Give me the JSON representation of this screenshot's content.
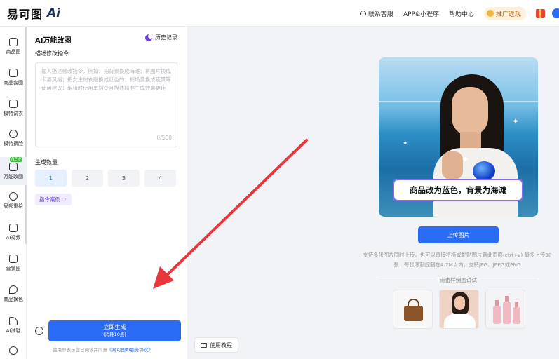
{
  "header": {
    "logo_text": "易可图",
    "logo_ai": "Ai",
    "nav": [
      "联系客服",
      "APP&小程序",
      "帮助中心"
    ],
    "promo_label": "推广返现"
  },
  "sidebar": {
    "items": [
      {
        "label": "商品图"
      },
      {
        "label": "商品套图"
      },
      {
        "label": "模特试衣"
      },
      {
        "label": "模特换脸"
      },
      {
        "label": "万能改图",
        "badge": "NEW"
      },
      {
        "label": "局部重绘"
      },
      {
        "label": "AI视频"
      },
      {
        "label": "营销图"
      },
      {
        "label": "商品换色"
      },
      {
        "label": "AI试鞋"
      },
      {
        "label": ""
      }
    ]
  },
  "panel": {
    "title": "AI万能改图",
    "history": "历史记录",
    "desc_label": "描述修改指令",
    "textarea_placeholder": "输入描述修改指令，例如：把背景换成海滩；将图片换成卡通风格；把女生的衣服换成红色的；把场景换成夜景等\n使用建议：编辑时使用单指令且描述精准生成效果更佳",
    "counter": "0/500",
    "count_label": "生成数量",
    "counts": [
      "1",
      "2",
      "3",
      "4"
    ],
    "case_label": "指令案例",
    "generate_label": "立即生成",
    "generate_sub": "(消耗10点)",
    "agree_text": "使用即表示您已阅读并同意",
    "agree_link": "《易可图AI服务协议》"
  },
  "main": {
    "hero_caption": "商品改为蓝色，背景为海滩",
    "upload_label": "上传图片",
    "tip": "支持多张图片同时上传，也可以直接将拖或黏贴图片到此页面(ctrl+v) 最多上传30张，每张限制控制在4.7M以内，支持JPG、JPEG或PNG",
    "samples_title": "点击样例图试试",
    "tutorial_label": "使用教程"
  },
  "colors": {
    "accent": "#2b6cf6",
    "purple": "#6a3ee8",
    "arrow": "#e8363a"
  }
}
